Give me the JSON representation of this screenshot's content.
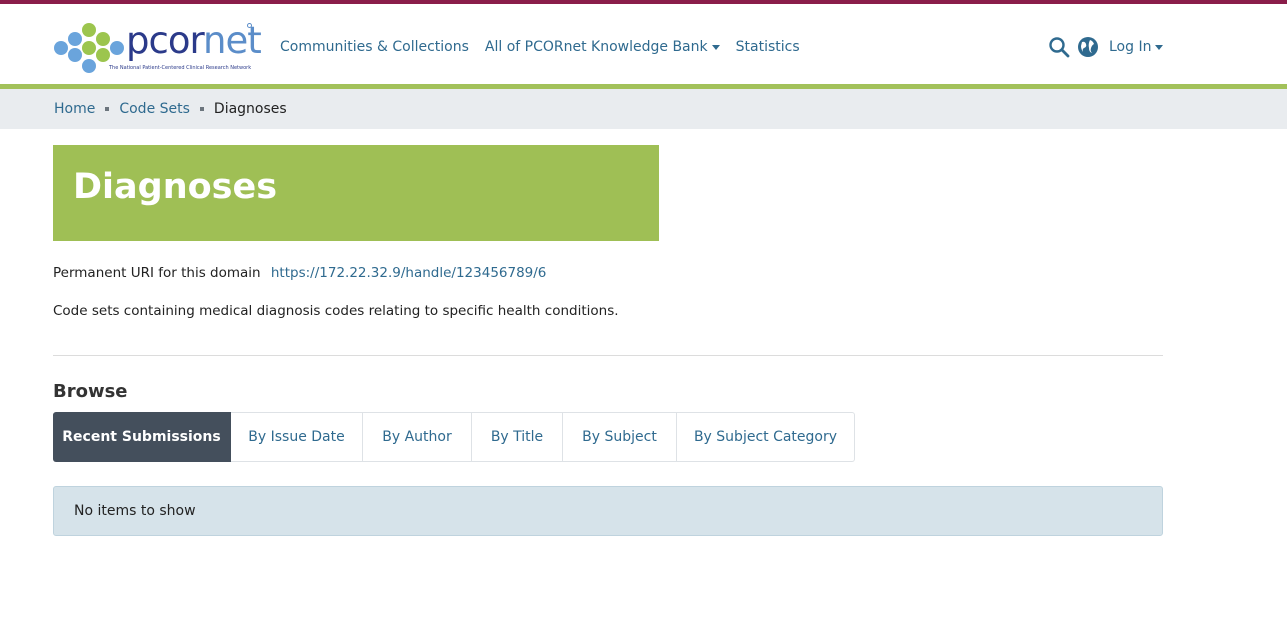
{
  "header": {
    "logo": {
      "word_part1": "pcor",
      "word_part2": "net",
      "tagline": "The National Patient-Centered Clinical Research Network"
    },
    "nav": [
      {
        "label": "Communities & Collections",
        "dropdown": false
      },
      {
        "label": "All of PCORnet Knowledge Bank",
        "dropdown": true
      },
      {
        "label": "Statistics",
        "dropdown": false
      }
    ],
    "search_icon": "search-icon",
    "language_icon": "globe-icon",
    "login_label": "Log In",
    "colors": {
      "accent_top": "#8a1d4a",
      "accent_bottom": "#a2c15a",
      "link": "#2f6a8f"
    }
  },
  "breadcrumb": {
    "items": [
      "Home",
      "Code Sets"
    ],
    "current": "Diagnoses"
  },
  "page": {
    "title": "Diagnoses",
    "title_bg": "#9fbf55",
    "uri_label": "Permanent URI for this domain",
    "uri_value": "https://172.22.32.9/handle/123456789/6",
    "description": "Code sets containing medical diagnosis codes relating to specific health conditions."
  },
  "browse": {
    "heading": "Browse",
    "tabs": [
      {
        "label": "Recent Submissions",
        "active": true
      },
      {
        "label": "By Issue Date",
        "active": false
      },
      {
        "label": "By Author",
        "active": false
      },
      {
        "label": "By Title",
        "active": false
      },
      {
        "label": "By Subject",
        "active": false
      },
      {
        "label": "By Subject Category",
        "active": false
      }
    ],
    "empty_message": "No items to show"
  }
}
